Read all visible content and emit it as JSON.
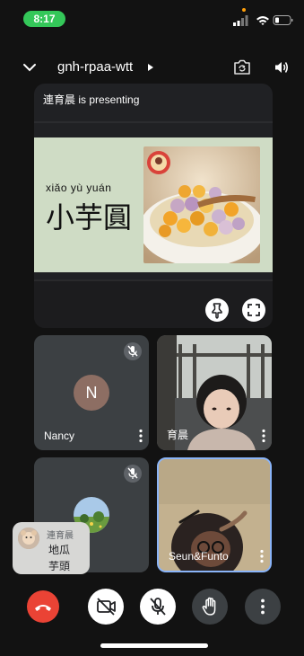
{
  "status_bar": {
    "time": "8:17"
  },
  "header": {
    "meeting_code": "gnh-rpaa-wtt"
  },
  "presentation": {
    "label": "連育晨 is presenting",
    "slide_pinyin": "xiǎo yù yuán",
    "slide_title": "小芋圓"
  },
  "participants": [
    {
      "name": "Nancy",
      "initial": "N",
      "muted": true,
      "avatar_color": "#8d6e63"
    },
    {
      "name": "育晨",
      "muted": false
    },
    {
      "name": "",
      "muted": true
    },
    {
      "name": "Seun&Funto",
      "muted": false,
      "active_speaker": true
    }
  ],
  "self_preview": {
    "name": "連育晨",
    "line1": "地瓜",
    "line2": "芋頭"
  },
  "controls": {
    "end_call_color": "#ea4335",
    "items": [
      "end-call",
      "camera-off",
      "mic-off",
      "raise-hand",
      "more-options"
    ]
  },
  "colors": {
    "status_green": "#34c759",
    "active_border": "#8ab4f8",
    "tile_bg": "#3c4043"
  }
}
